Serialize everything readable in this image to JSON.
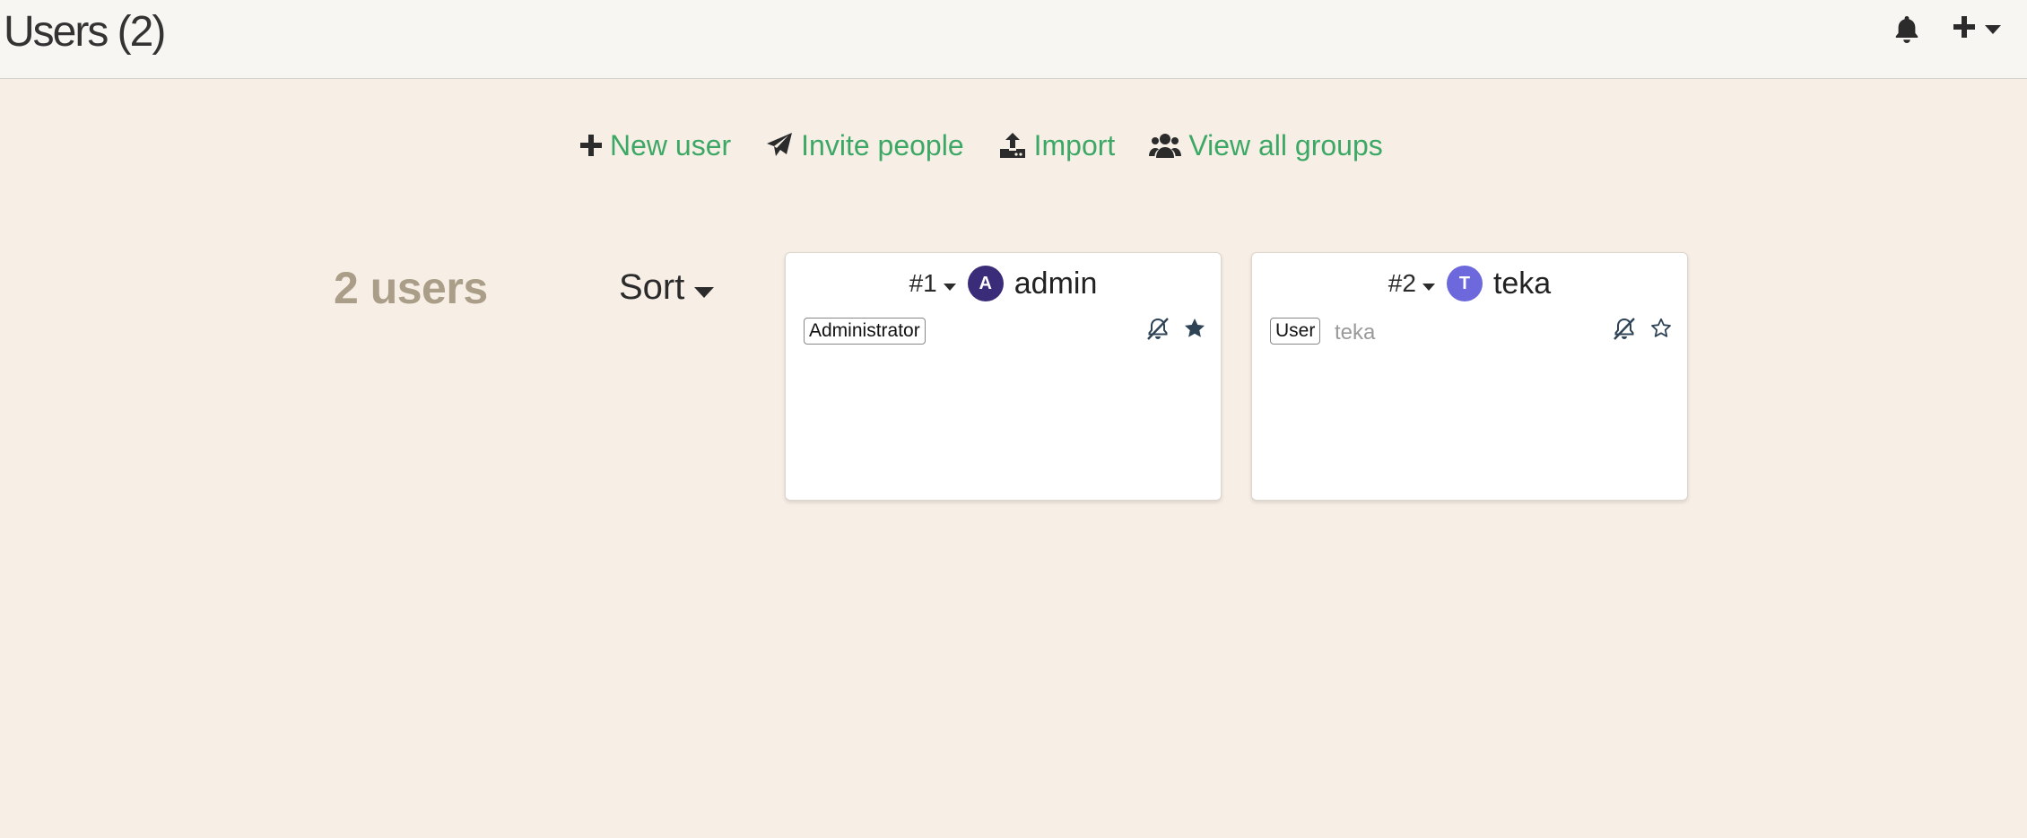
{
  "header": {
    "title": "Users (2)",
    "notifications_icon": "bell-icon",
    "add_menu_icon": "plus-caret-icon"
  },
  "actions": [
    {
      "label": "New user",
      "icon": "plus-icon"
    },
    {
      "label": "Invite people",
      "icon": "paper-plane-icon"
    },
    {
      "label": "Import",
      "icon": "upload-icon"
    },
    {
      "label": "View all groups",
      "icon": "users-group-icon"
    }
  ],
  "summary": {
    "count_text": "2 users",
    "sort_label": "Sort"
  },
  "users": [
    {
      "number": "#1",
      "avatar_letter": "A",
      "avatar_color": "#3b2c7a",
      "name": "admin",
      "role": "Administrator",
      "login": "",
      "muted_icon": "bell-slash-icon",
      "star_icon": "star-filled-icon"
    },
    {
      "number": "#2",
      "avatar_letter": "T",
      "avatar_color": "#6d69dd",
      "name": "teka",
      "role": "User",
      "login": "teka",
      "muted_icon": "bell-slash-icon",
      "star_icon": "star-outline-icon"
    }
  ],
  "colors": {
    "background": "#f7efe6",
    "topbar": "#f8f6f3",
    "accent_green": "#3da865",
    "count_tan": "#ab9e88",
    "icon_slate": "#2f4357"
  }
}
